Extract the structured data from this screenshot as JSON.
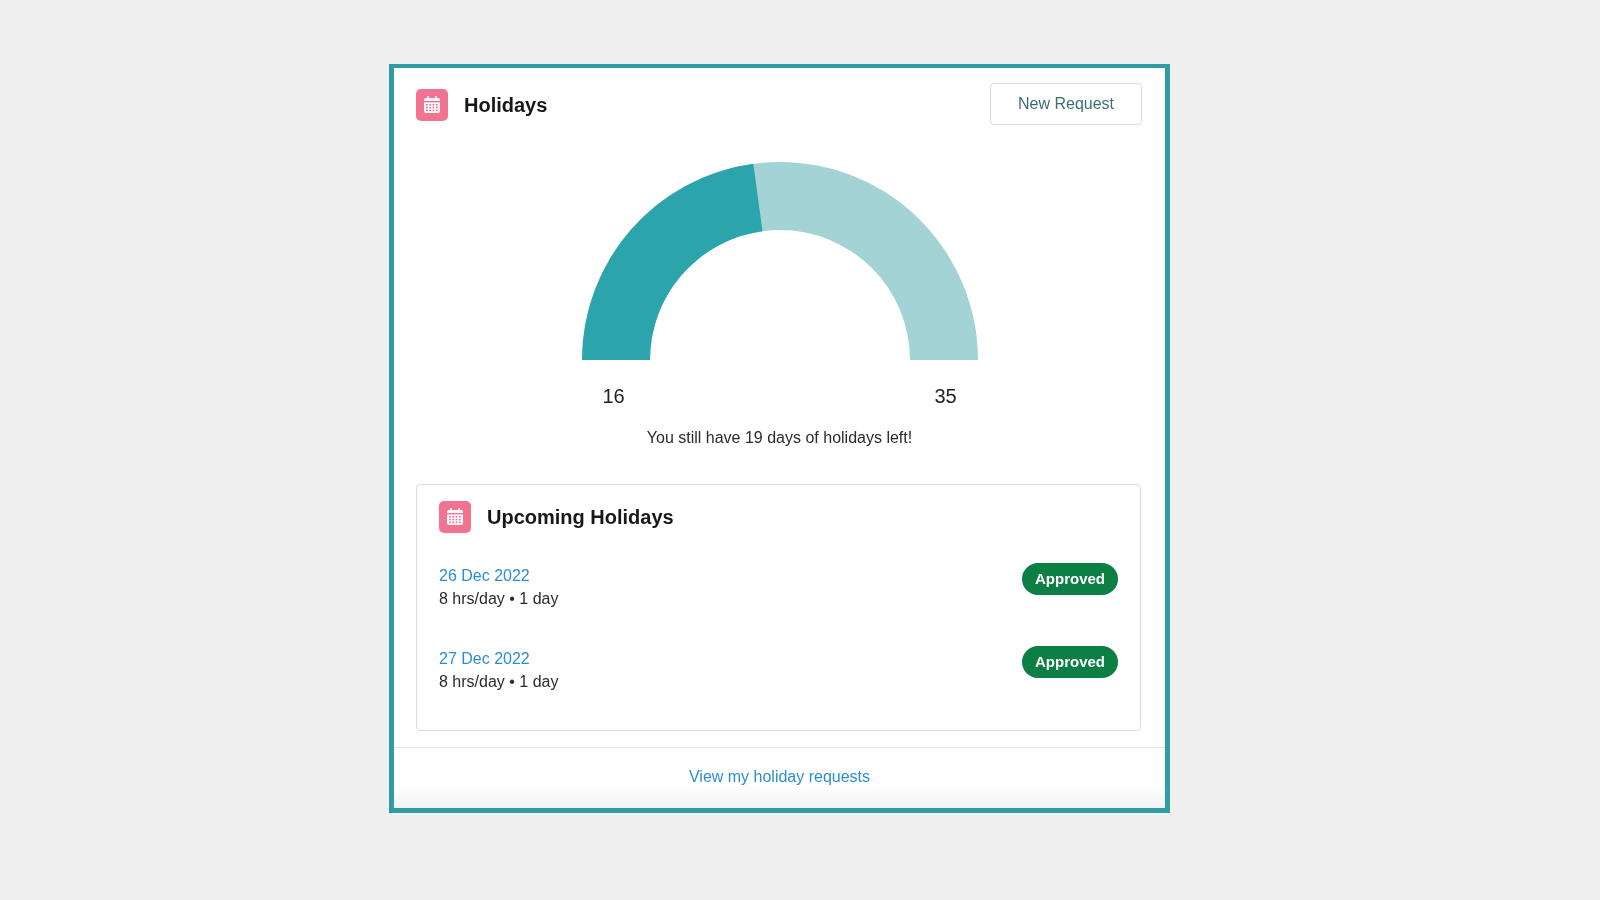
{
  "card": {
    "title": "Holidays",
    "action": "New Request"
  },
  "gauge": {
    "level": 0.457,
    "start_label": "16",
    "end_label": "35",
    "message": "You still have 19 days of holidays left!"
  },
  "upcoming": {
    "title": "Upcoming Holidays",
    "items": [
      {
        "date": "26 Dec 2022",
        "details": "8 hrs/day • 1 day",
        "status": "Approved"
      },
      {
        "date": "27 Dec 2022",
        "details": "8 hrs/day • 1 day",
        "status": "Approved"
      }
    ]
  },
  "footer_link": "View my holiday requests"
}
